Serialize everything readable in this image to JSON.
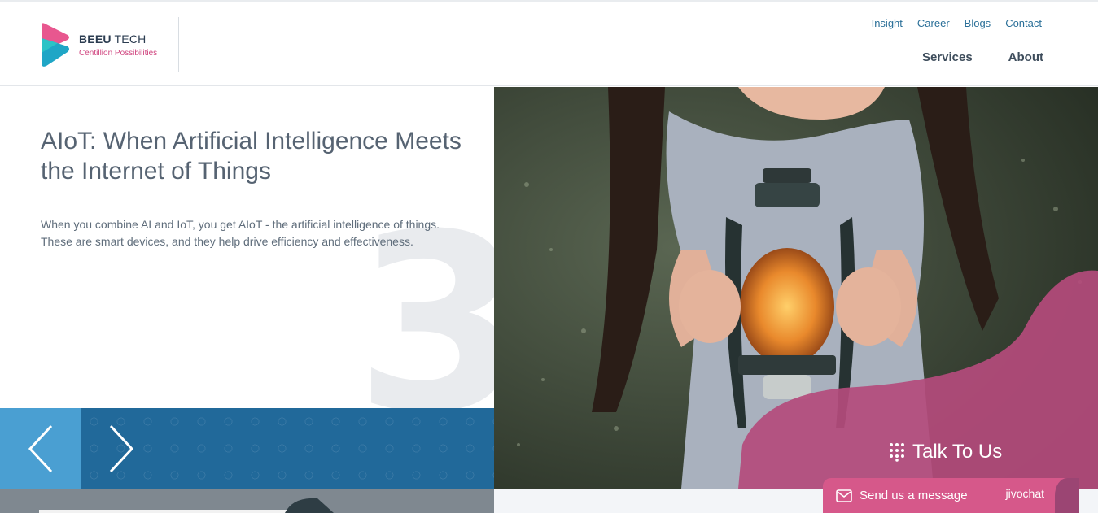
{
  "brand": {
    "name_bold": "BEEU",
    "name_rest": " TECH",
    "tagline": "Centillion Possibilities"
  },
  "top_links": [
    "Insight",
    "Career",
    "Blogs",
    "Contact"
  ],
  "main_nav": [
    "Services",
    "About"
  ],
  "hero": {
    "title": "AIoT: When Artificial Intelligence Meets the Internet of Things",
    "description": "When you combine AI and IoT, you get AIoT - the artificial intelligence of things. These are smart devices, and they help drive efficiency and effectiveness.",
    "slide_number": "3"
  },
  "talk": {
    "label": "Talk To Us"
  },
  "chat": {
    "label": "Send us a message",
    "brand": "jivochat"
  },
  "colors": {
    "accent_blue": "#21699a",
    "light_blue": "#4a9fd2",
    "brand_pink": "#d6588a",
    "blob_pink": "#b44b7c"
  },
  "icons": {
    "prev": "chevron-left-icon",
    "next": "chevron-right-icon",
    "talk": "dots-grid-icon",
    "chat": "envelope-icon"
  }
}
